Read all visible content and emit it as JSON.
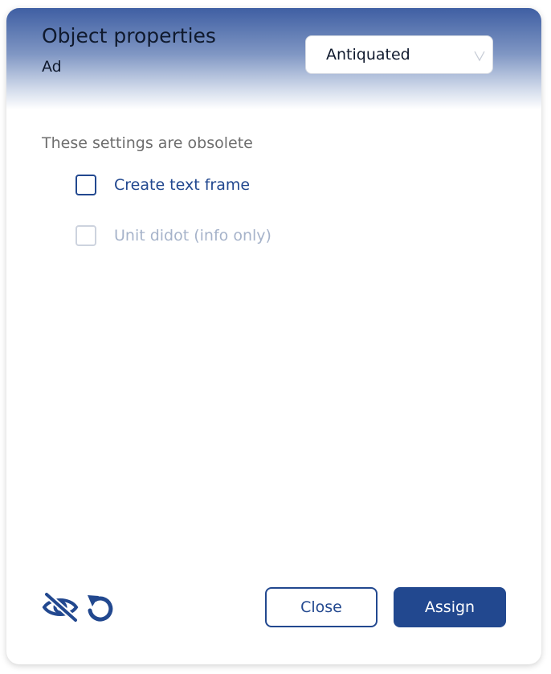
{
  "header": {
    "title": "Object properties",
    "subtitle": "Ad",
    "select_value": "Antiquated"
  },
  "section": {
    "label": "These settings are obsolete"
  },
  "options": [
    {
      "label": "Create text frame",
      "checked": false,
      "disabled": false
    },
    {
      "label": "Unit didot (info only)",
      "checked": false,
      "disabled": true
    }
  ],
  "footer": {
    "icons": [
      "eye-off-icon",
      "reset-icon"
    ],
    "close_label": "Close",
    "assign_label": "Assign"
  },
  "colors": {
    "accent": "#22488f",
    "header_top": "#3f5fa3",
    "disabled_text": "#a6b3ca",
    "muted_text": "#6e6e6e"
  }
}
